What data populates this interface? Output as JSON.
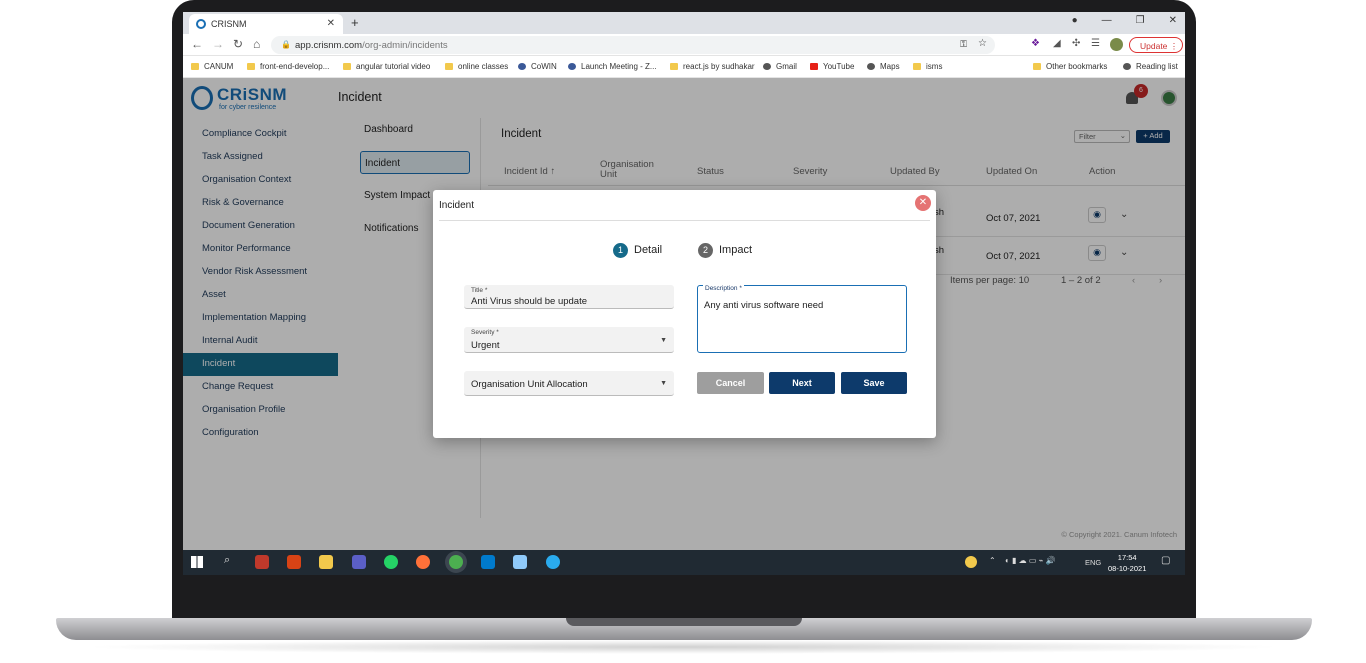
{
  "browser": {
    "tab_title": "CRISNM",
    "url_host": "app.crisnm.com",
    "url_path": "/org-admin/incidents",
    "update_label": "Update",
    "bookmarks": [
      "CANUM",
      "front-end-develop...",
      "angular tutorial video",
      "online classes",
      "CoWIN",
      "Launch Meeting - Z...",
      "react.js by sudhakar",
      "Gmail",
      "YouTube",
      "Maps",
      "isms",
      "Other bookmarks",
      "Reading list"
    ]
  },
  "app": {
    "logo_text": "CRiSNM",
    "logo_tagline": "for cyber resilence",
    "page_title": "Incident",
    "notification_count": "6",
    "sidebar": [
      "Compliance Cockpit",
      "Task Assigned",
      "Organisation Context",
      "Risk & Governance",
      "Document Generation",
      "Monitor Performance",
      "Vendor Risk Assessment",
      "Asset",
      "Implementation Mapping",
      "Internal Audit",
      "Incident",
      "Change Request",
      "Organisation Profile",
      "Configuration"
    ],
    "subnav": [
      "Dashboard",
      "Incident",
      "System Impact",
      "Notifications"
    ],
    "main_title": "Incident",
    "filter_placeholder": "Filter",
    "add_label": "+ Add",
    "columns": [
      "Incident Id",
      "Organisation Unit",
      "Status",
      "Severity",
      "Updated By",
      "Updated On",
      "Action"
    ],
    "rows": [
      {
        "updated_by": "sh",
        "updated_on": "Oct 07, 2021"
      },
      {
        "updated_by": "sh",
        "updated_on": "Oct 07, 2021"
      }
    ],
    "items_per_page": "Items per page: 10",
    "range": "1 – 2 of 2",
    "footer": "© Copyright 2021. Canum Infotech"
  },
  "modal": {
    "title": "Incident",
    "step1_num": "1",
    "step1_label": "Detail",
    "step2_num": "2",
    "step2_label": "Impact",
    "title_label": "Title *",
    "title_value": "Anti Virus should be update",
    "severity_label": "Severity *",
    "severity_value": "Urgent",
    "org_unit_value": "Organisation Unit Allocation",
    "description_label": "Description *",
    "description_value": "Any anti virus software need",
    "cancel_label": "Cancel",
    "next_label": "Next",
    "save_label": "Save"
  },
  "taskbar": {
    "lang": "ENG",
    "time": "17:54",
    "date": "08-10-2021"
  }
}
